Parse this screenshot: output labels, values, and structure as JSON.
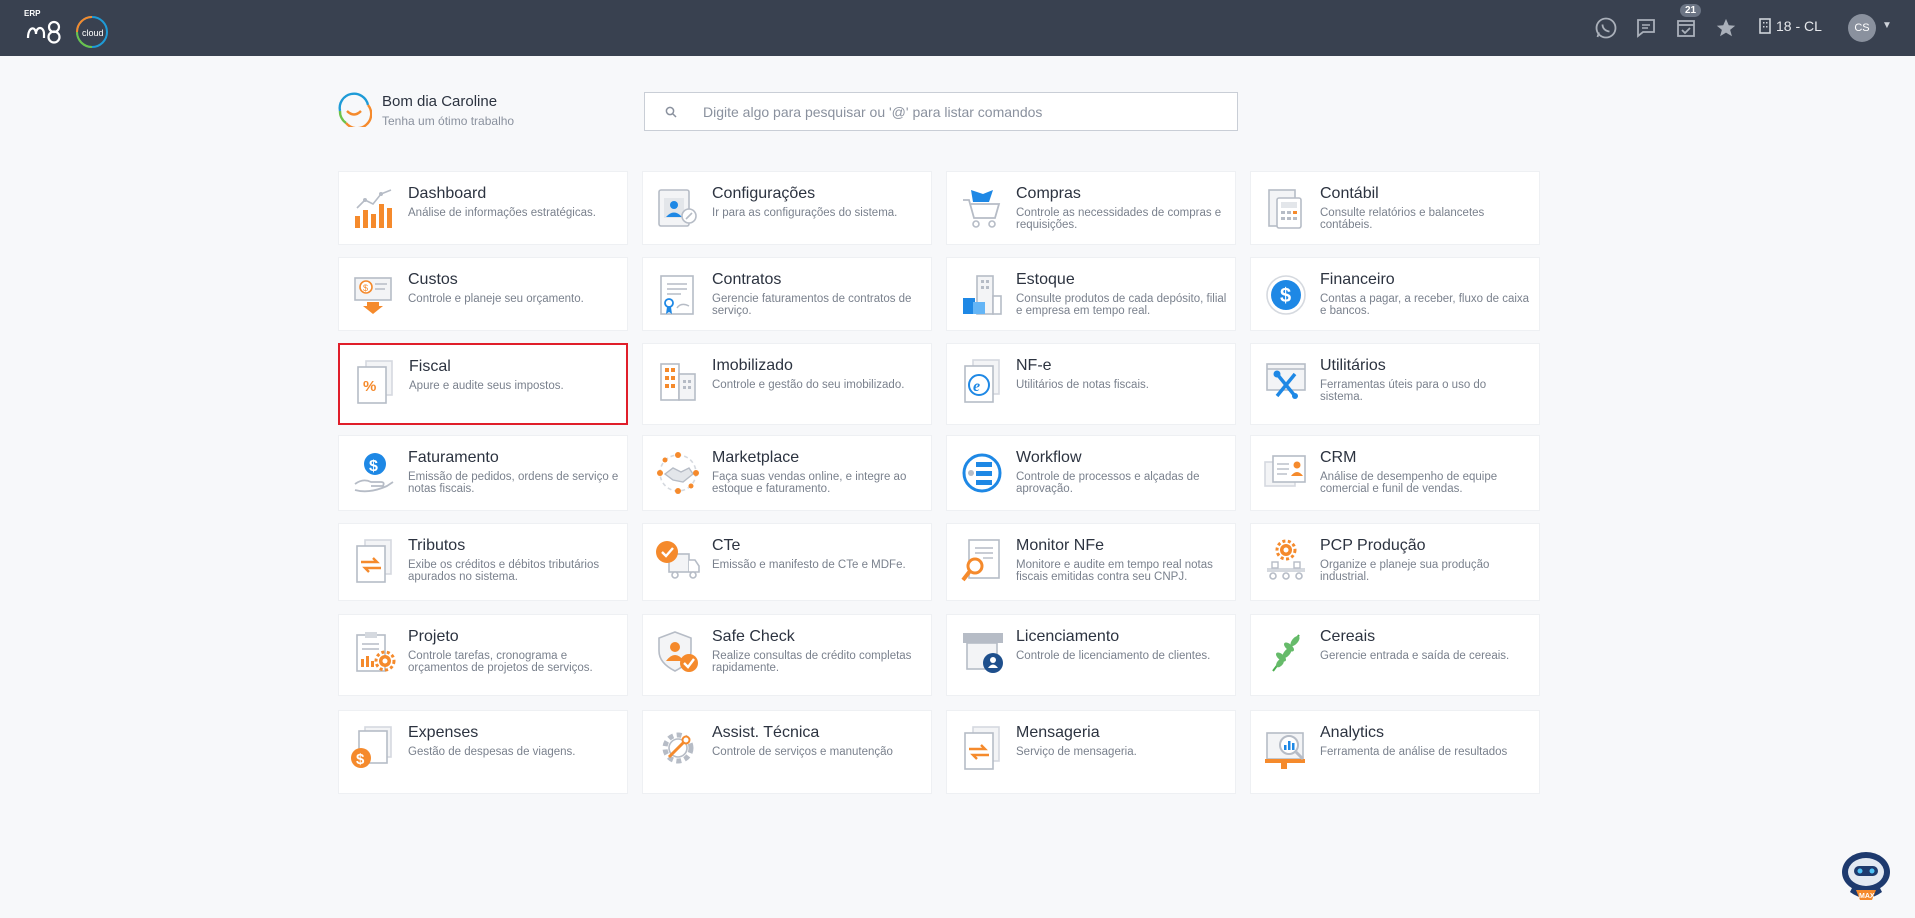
{
  "header": {
    "logo_prefix": "ERP",
    "logo_suffix": "cloud",
    "notifications_count": "21",
    "company": "18 - CL",
    "user_initials": "CS"
  },
  "greeting": {
    "title": "Bom dia Caroline",
    "subtitle": "Tenha um ótimo trabalho"
  },
  "search": {
    "placeholder": "Digite algo para pesquisar ou '@' para listar comandos"
  },
  "modules": [
    {
      "title": "Dashboard",
      "desc": "Análise de informações estratégicas.",
      "icon": "dashboard-icon"
    },
    {
      "title": "Configurações",
      "desc": "Ir para as configurações do sistema.",
      "icon": "settings-icon"
    },
    {
      "title": "Compras",
      "desc": "Controle as necessidades de compras e requisições.",
      "icon": "cart-icon"
    },
    {
      "title": "Contábil",
      "desc": "Consulte relatórios e balancetes contábeis.",
      "icon": "calculator-icon"
    },
    {
      "title": "Custos",
      "desc": "Controle e planeje seu orçamento.",
      "icon": "costs-icon"
    },
    {
      "title": "Contratos",
      "desc": "Gerencie faturamentos de contratos de serviço.",
      "icon": "contract-icon"
    },
    {
      "title": "Estoque",
      "desc": "Consulte produtos de cada depósito, filial e empresa em tempo real.",
      "icon": "stock-icon"
    },
    {
      "title": "Financeiro",
      "desc": "Contas a pagar, a receber, fluxo de caixa e bancos.",
      "icon": "dollar-icon"
    },
    {
      "title": "Fiscal",
      "desc": "Apure e audite seus impostos.",
      "icon": "percent-document-icon"
    },
    {
      "title": "Imobilizado",
      "desc": "Controle e gestão do seu imobilizado.",
      "icon": "building-icon"
    },
    {
      "title": "NF-e",
      "desc": "Utilitários de notas fiscais.",
      "icon": "nfe-document-icon"
    },
    {
      "title": "Utilitários",
      "desc": "Ferramentas úteis para o uso do sistema.",
      "icon": "tools-icon"
    },
    {
      "title": "Faturamento",
      "desc": "Emissão de pedidos, ordens de serviço e notas fiscais.",
      "icon": "billing-hand-icon"
    },
    {
      "title": "Marketplace",
      "desc": "Faça suas vendas online, e integre ao estoque e faturamento.",
      "icon": "handshake-icon"
    },
    {
      "title": "Workflow",
      "desc": "Controle de processos e alçadas de aprovação.",
      "icon": "workflow-icon"
    },
    {
      "title": "CRM",
      "desc": "Análise de desempenho de equipe comercial e funil de vendas.",
      "icon": "crm-icon"
    },
    {
      "title": "Tributos",
      "desc": "Exibe os créditos e débitos tributários apurados no sistema.",
      "icon": "exchange-document-icon"
    },
    {
      "title": "CTe",
      "desc": "Emissão e manifesto de CTe e MDFe.",
      "icon": "truck-check-icon"
    },
    {
      "title": "Monitor NFe",
      "desc": "Monitore e audite em tempo real notas fiscais emitidas contra seu CNPJ.",
      "icon": "magnifier-document-icon"
    },
    {
      "title": "PCP Produção",
      "desc": "Organize e planeje sua produção industrial.",
      "icon": "production-gear-icon"
    },
    {
      "title": "Projeto",
      "desc": "Controle tarefas, cronograma e orçamentos de projetos de serviços.",
      "icon": "clipboard-gear-icon"
    },
    {
      "title": "Safe Check",
      "desc": "Realize consultas de crédito completas rapidamente.",
      "icon": "shield-check-icon"
    },
    {
      "title": "Licenciamento",
      "desc": "Controle de licenciamento de clientes.",
      "icon": "license-icon"
    },
    {
      "title": "Cereais",
      "desc": "Gerencie entrada e saída de cereais.",
      "icon": "wheat-icon"
    },
    {
      "title": "Expenses",
      "desc": "Gestão de despesas de viagens.",
      "icon": "expenses-icon"
    },
    {
      "title": "Assist. Técnica",
      "desc": "Controle de serviços e manutenção",
      "icon": "wrench-gear-icon"
    },
    {
      "title": "Mensageria",
      "desc": "Serviço de mensageria.",
      "icon": "message-document-icon"
    },
    {
      "title": "Analytics",
      "desc": "Ferramenta de análise de resultados",
      "icon": "analytics-icon"
    }
  ],
  "assistant": {
    "label": "MAX"
  },
  "colors": {
    "topbar": "#394150",
    "accent_orange": "#f58a2c",
    "accent_blue": "#1e88e5",
    "selected_border": "#e01e2a"
  }
}
